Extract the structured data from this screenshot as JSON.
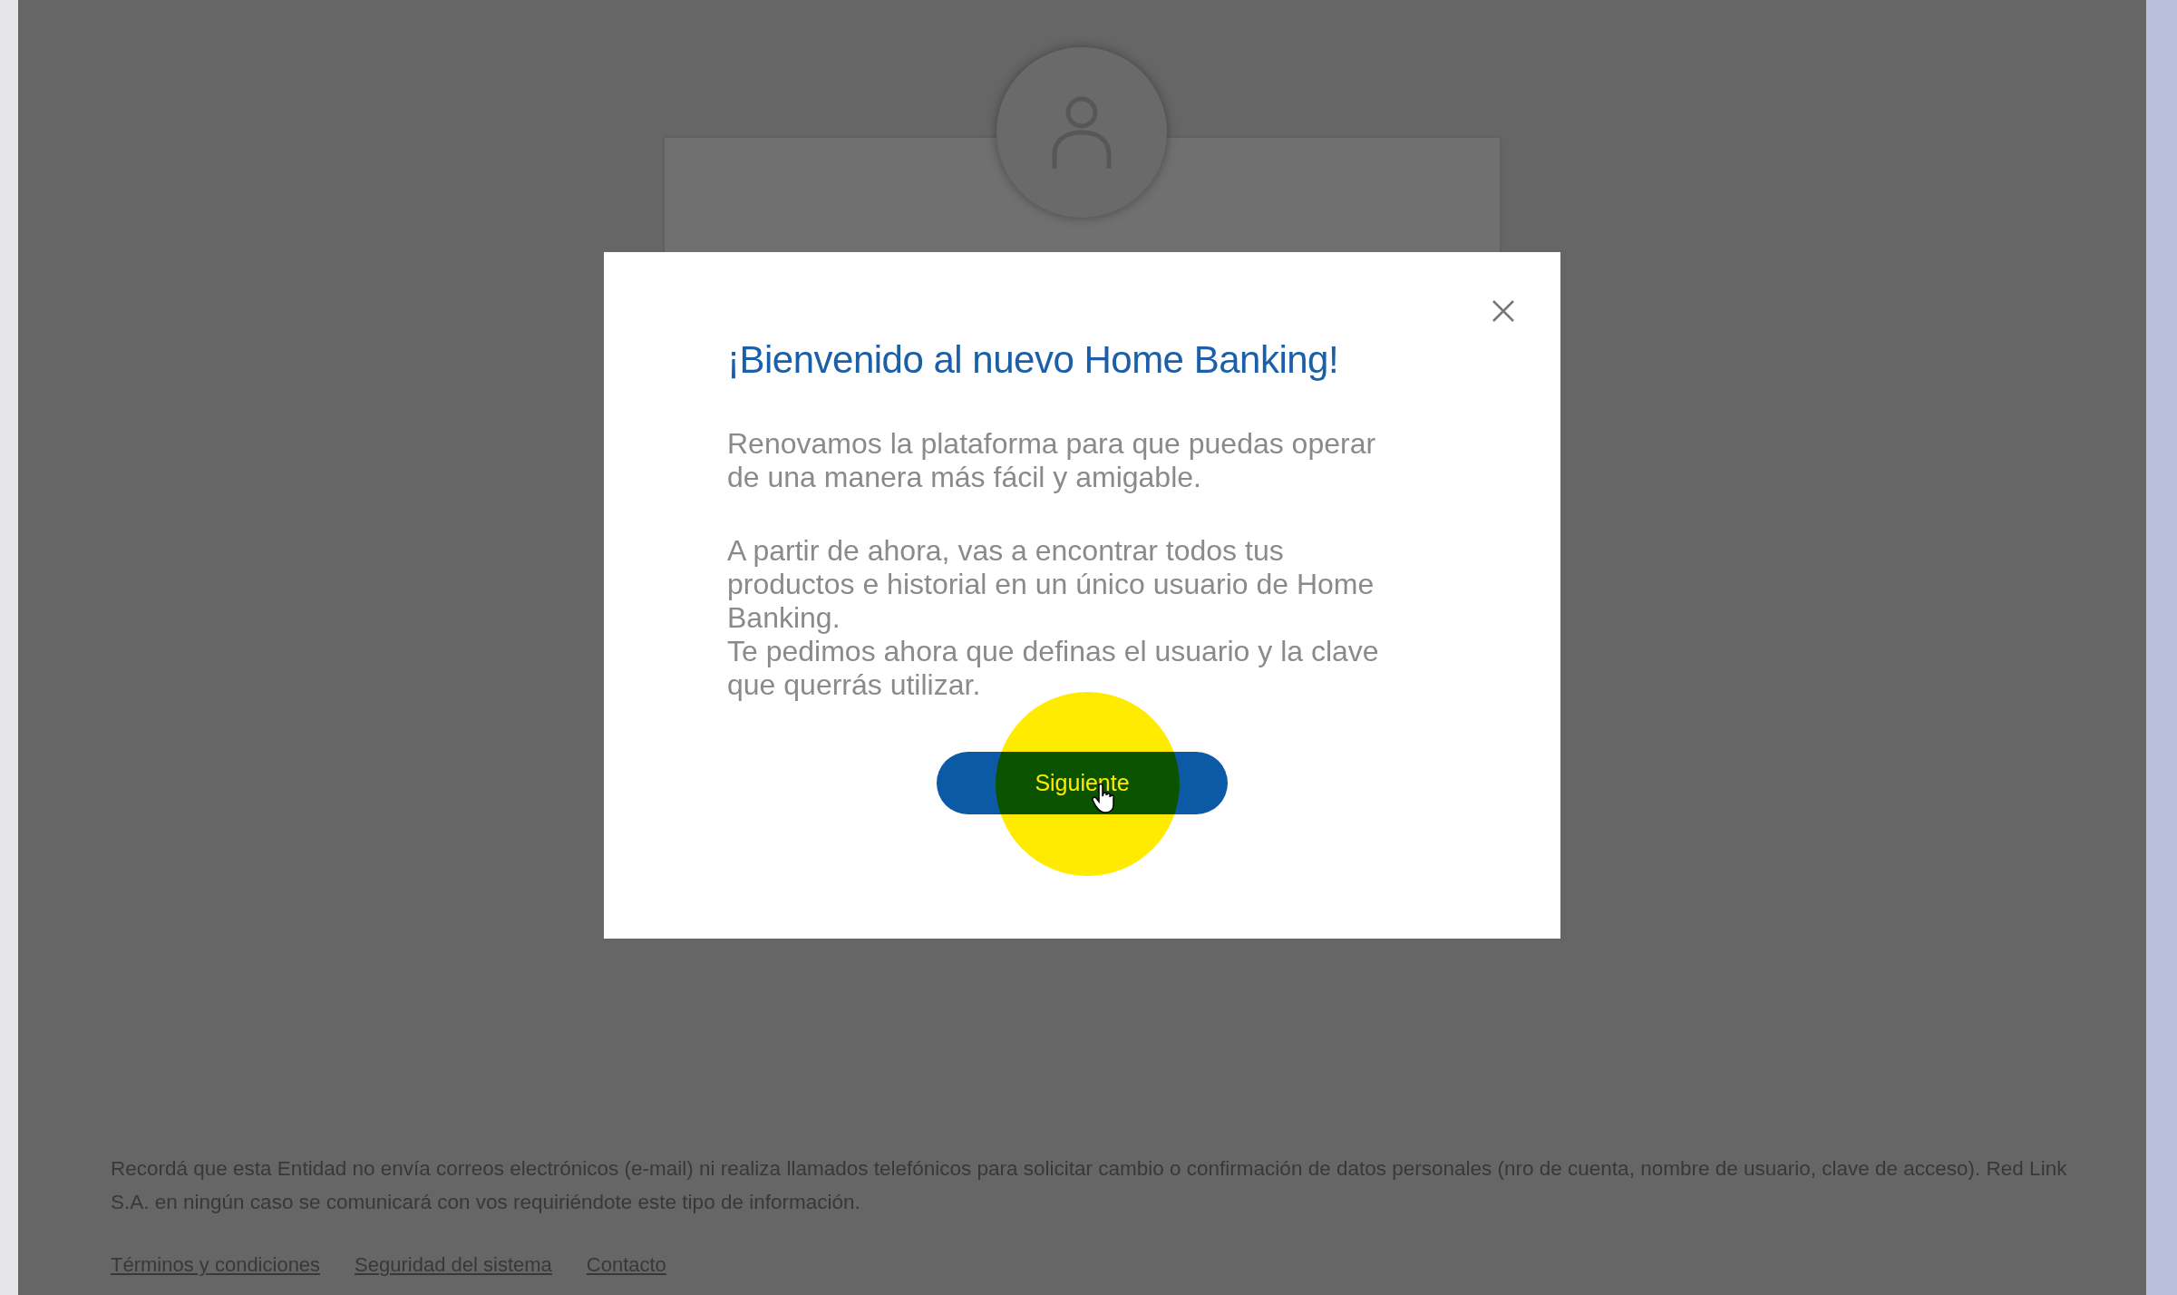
{
  "modal": {
    "title": "¡Bienvenido al nuevo Home Banking!",
    "paragraphs": [
      [
        "Renovamos la plataforma para que puedas operar de una manera más fácil y amigable."
      ],
      [
        "A partir de ahora, vas a encontrar todos tus productos e historial en un único usuario de Home Banking.",
        "Te pedimos ahora que definas el usuario y la clave que querrás utilizar."
      ]
    ],
    "button": "Siguiente"
  },
  "footer": {
    "notice": "Recordá que esta Entidad no envía correos electrónicos (e-mail) ni realiza llamados telefónicos para solicitar cambio o confirmación de datos personales (nro de cuenta, nombre de usuario, clave de acceso). Red Link S.A. en ningún caso se comunicará con vos requiriéndote este tipo de información.",
    "links": [
      "Términos y condiciones",
      "Seguridad del sistema",
      "Contacto"
    ]
  }
}
